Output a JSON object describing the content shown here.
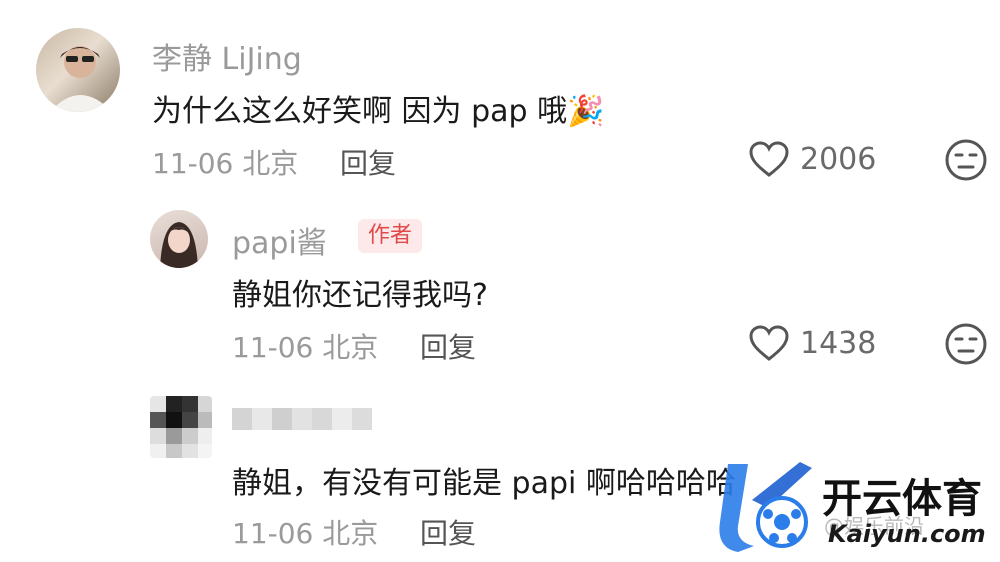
{
  "comments": [
    {
      "username": "李静 LiJing",
      "text": "为什么这么好笑啊 因为 pap 哦",
      "emoji": "🎉",
      "date": "11-06",
      "location": "北京",
      "reply_label": "回复",
      "likes": "2006"
    },
    {
      "username": "papi酱",
      "badge": "作者",
      "text": "静姐你还记得我吗?",
      "date": "11-06",
      "location": "北京",
      "reply_label": "回复",
      "likes": "1438"
    },
    {
      "username": "",
      "text": "静姐，有没有可能是 papi 啊哈哈哈哈",
      "date": "11-06",
      "location": "北京",
      "reply_label": "回复"
    }
  ],
  "watermark": {
    "brand": "开云体育",
    "domain": "Kaiyun.com",
    "overlay": "@娱乐前沿"
  },
  "icons": {
    "like": "heart-outline-icon",
    "dislike": "neutral-face-icon",
    "watermark_logo": "k-soccer-logo"
  }
}
